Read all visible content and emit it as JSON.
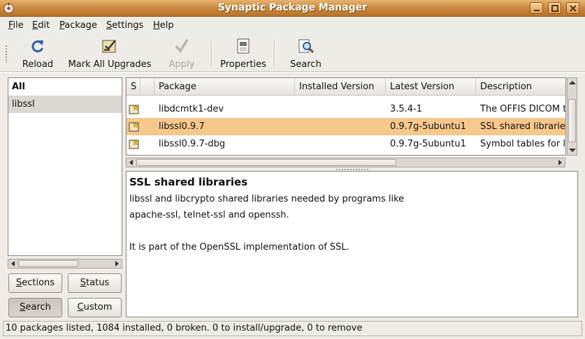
{
  "window": {
    "title": "Synaptic Package Manager",
    "buttons": [
      "minimize",
      "maximize",
      "close"
    ]
  },
  "menubar": {
    "items": [
      {
        "mnemonic": "F",
        "rest": "ile"
      },
      {
        "mnemonic": "E",
        "rest": "dit"
      },
      {
        "mnemonic": "P",
        "rest": "ackage"
      },
      {
        "mnemonic": "S",
        "rest": "ettings"
      },
      {
        "mnemonic": "H",
        "rest": "elp"
      }
    ]
  },
  "toolbar": {
    "reload": "Reload",
    "mark_all_upgrades": "Mark All Upgrades",
    "apply": "Apply",
    "properties": "Properties",
    "search": "Search"
  },
  "filter_panel": {
    "items": [
      "All",
      "libssl"
    ],
    "selected": "libssl",
    "buttons": {
      "sections": {
        "mnemonic": "S",
        "rest": "ections"
      },
      "status": {
        "mnemonic": "S",
        "rest": "tatus"
      },
      "search": {
        "mnemonic": "S",
        "rest": "earch"
      },
      "custom": {
        "mnemonic": "C",
        "rest": "ustom"
      }
    }
  },
  "package_table": {
    "columns": [
      "S",
      "Package",
      "Installed Version",
      "Latest Version",
      "Description"
    ],
    "rows": [
      {
        "package": "libdcmtk1-dev",
        "installed": "",
        "latest": "3.5.4-1",
        "description": "The OFFIS DICOM toolkit development libraries"
      },
      {
        "package": "libssl0.9.7",
        "installed": "",
        "latest": "0.9.7g-5ubuntu1",
        "description": "SSL shared libraries"
      },
      {
        "package": "libssl0.9.7-dbg",
        "installed": "",
        "latest": "0.9.7g-5ubuntu1",
        "description": "Symbol tables for libssl"
      }
    ],
    "selected_row": 1
  },
  "description_pane": {
    "title": "SSL shared libraries",
    "lines": [
      "libssl and libcrypto shared libraries needed by programs like",
      "apache-ssl, telnet-ssl and openssh.",
      "",
      "It is part of the OpenSSL implementation of SSL."
    ]
  },
  "statusbar": {
    "text": "10 packages listed, 1084 installed, 0 broken. 0 to install/upgrade, 0 to remove"
  },
  "colors": {
    "titlebar": "#c9863a",
    "selection": "#f7c88c",
    "background": "#efebe7"
  }
}
